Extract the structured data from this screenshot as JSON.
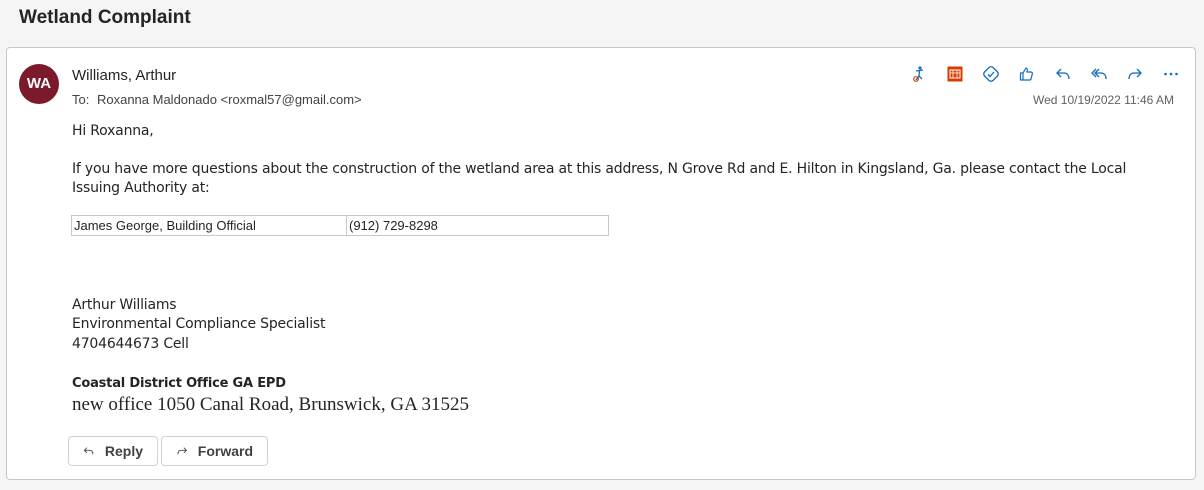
{
  "subject": "Wetland Complaint",
  "sender": {
    "initials": "WA",
    "name": "Williams, Arthur",
    "to_label": "To:",
    "to_value": "Roxanna Maldonado <roxmal57@gmail.com>",
    "date": "Wed 10/19/2022 11:46 AM"
  },
  "colors": {
    "avatar": "#7a1a2a",
    "icon_blue": "#0f6cbd",
    "icon_red": "#d83b01"
  },
  "toolbar": {
    "icons": [
      "accessibility-icon",
      "calendar-icon",
      "link-icon",
      "like-icon",
      "reply-icon",
      "reply-all-icon",
      "forward-icon",
      "more-icon"
    ]
  },
  "body": {
    "greeting": "Hi Roxanna,",
    "paragraph": "If you have more questions about the construction of the wetland area at this address, N Grove Rd and E. Hilton in Kingsland, Ga.  please contact the Local Issuing Authority at:",
    "table": [
      [
        "James George, Building Official",
        "(912) 729-8298"
      ]
    ],
    "signature": {
      "name": "Arthur Williams",
      "title": "Environmental Compliance Specialist",
      "phone": "4704644673 Cell",
      "office": "Coastal District Office  GA EPD",
      "address": "new office 1050 Canal Road, Brunswick, GA  31525"
    }
  },
  "actions": {
    "reply": "Reply",
    "forward": "Forward"
  }
}
